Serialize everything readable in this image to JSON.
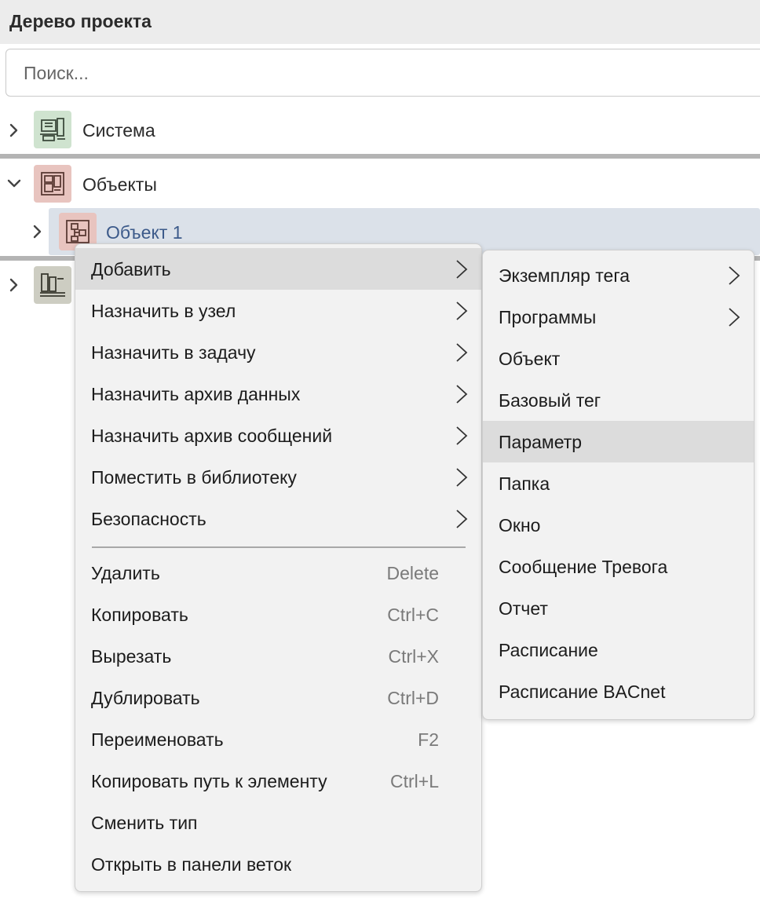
{
  "panel": {
    "title": "Дерево проекта"
  },
  "search": {
    "placeholder": "Поиск..."
  },
  "tree": {
    "system": {
      "label": "Система",
      "icon": "computer-system-icon",
      "icon_bg": "#cfe3cf"
    },
    "objects": {
      "label": "Объекты",
      "icon": "floor-plan-icon",
      "icon_bg": "#e8c4bf"
    },
    "object1": {
      "label": "Объект 1",
      "icon": "object-tree-icon",
      "icon_bg": "#e8c4bf"
    },
    "fourth": {
      "label": "",
      "icon": "library-books-icon",
      "icon_bg": "#cdcdc2"
    }
  },
  "context_menu": {
    "items": [
      {
        "label": "Добавить",
        "submenu": true,
        "highlighted": true
      },
      {
        "label": "Назначить в узел",
        "submenu": true
      },
      {
        "label": "Назначить в задачу",
        "submenu": true
      },
      {
        "label": "Назначить архив данных",
        "submenu": true
      },
      {
        "label": "Назначить архив сообщений",
        "submenu": true
      },
      {
        "label": "Поместить в библиотеку",
        "submenu": true
      },
      {
        "label": "Безопасность",
        "submenu": true
      },
      {
        "label": "Удалить",
        "shortcut": "Delete"
      },
      {
        "label": "Копировать",
        "shortcut": "Ctrl+C"
      },
      {
        "label": "Вырезать",
        "shortcut": "Ctrl+X"
      },
      {
        "label": "Дублировать",
        "shortcut": "Ctrl+D"
      },
      {
        "label": "Переименовать",
        "shortcut": "F2"
      },
      {
        "label": "Копировать путь к элементу",
        "shortcut": "Ctrl+L"
      },
      {
        "label": "Сменить тип"
      },
      {
        "label": "Открыть в панели веток"
      }
    ]
  },
  "submenu": {
    "items": [
      {
        "label": "Экземпляр тега",
        "submenu": true
      },
      {
        "label": "Программы",
        "submenu": true
      },
      {
        "label": "Объект"
      },
      {
        "label": "Базовый тег"
      },
      {
        "label": "Параметр",
        "highlighted": true
      },
      {
        "label": "Папка"
      },
      {
        "label": "Окно"
      },
      {
        "label": "Сообщение Тревога"
      },
      {
        "label": "Отчет"
      },
      {
        "label": "Расписание"
      },
      {
        "label": "Расписание BACnet"
      }
    ]
  },
  "colors": {
    "selection": "#dbe1e9",
    "menu_bg": "#f2f2f2",
    "menu_highlight": "#dcdcdc",
    "selected_text": "#3c5a8a"
  }
}
